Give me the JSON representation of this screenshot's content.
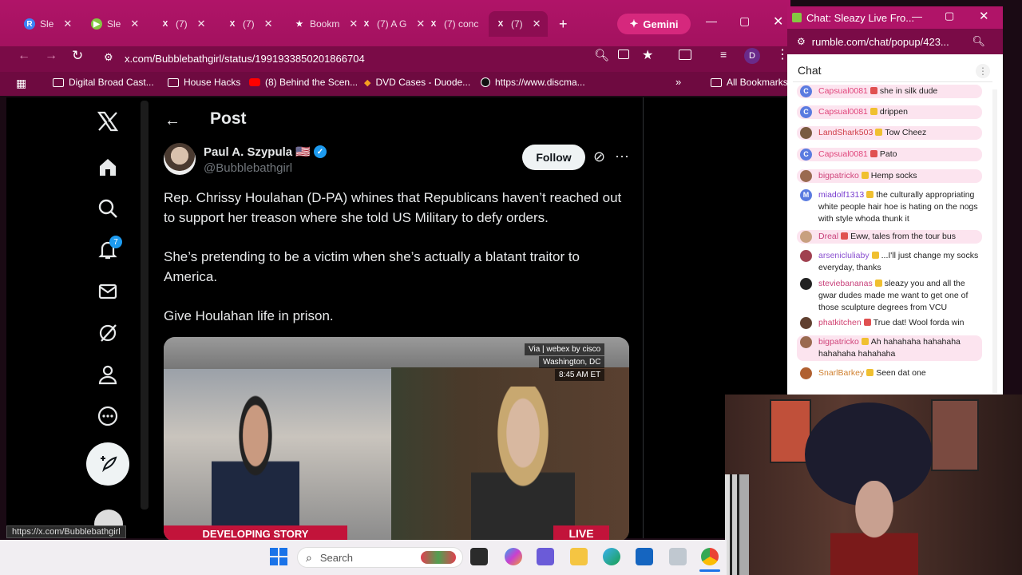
{
  "browser": {
    "tabs": [
      {
        "icon": "R",
        "label": "Sle",
        "color": "#3b82f6"
      },
      {
        "icon": "▶",
        "label": "Sle",
        "color": "#85c742"
      },
      {
        "icon": "X",
        "label": "(7)",
        "color": ""
      },
      {
        "icon": "X",
        "label": "(7)",
        "color": ""
      },
      {
        "icon": "★",
        "label": "Bookm",
        "color": ""
      },
      {
        "icon": "X",
        "label": "(7) A G",
        "color": ""
      },
      {
        "icon": "X",
        "label": "(7) conc",
        "color": ""
      },
      {
        "icon": "X",
        "label": "(7)",
        "color": ""
      }
    ],
    "gemini_label": "Gemini",
    "url": "x.com/Bubblebathgirl/status/1991933850201866704",
    "profile_initial": "D",
    "bookmarks": [
      "Digital Broad Cast...",
      "House Hacks",
      "(8) Behind the Scen...",
      "DVD Cases - Duode...",
      "https://www.discma...",
      "All Bookmarks"
    ],
    "status_url": "https://x.com/Bubblebathgirl"
  },
  "x": {
    "page_title": "Post",
    "notification_count": "7",
    "author_name": "Paul A. Szypula 🇺🇸",
    "author_handle": "@Bubblebathgirl",
    "follow_label": "Follow",
    "paragraphs": [
      "Rep. Chrissy Houlahan (D-PA) whines that Republicans haven’t reached out to support her treason where she told US Military to defy orders.",
      "She’s pretending to be a victim when she’s actually a blatant traitor to America.",
      "Give Houlahan life in prison."
    ],
    "media": {
      "via": "Via | webex by cisco",
      "location": "Washington, DC",
      "time": "8:45 AM ET",
      "banner": "DEVELOPING STORY",
      "live": "LIVE"
    }
  },
  "chat": {
    "window_title": "Chat: Sleazy Live Fro...",
    "url": "rumble.com/chat/popup/423...",
    "heading": "Chat",
    "messages": [
      {
        "user": "Capsual0081",
        "text": "she in silk dude",
        "color": "#e0457b",
        "av": "C",
        "avc": "#5a7be0",
        "hl": true
      },
      {
        "user": "Capsual0081",
        "text": "drippen",
        "color": "#e0457b",
        "av": "C",
        "avc": "#5a7be0",
        "hl": true
      },
      {
        "user": "LandShark503",
        "text": "Tow Cheez",
        "color": "#d0404a",
        "av": "",
        "avc": "#7a5a40",
        "hl": true
      },
      {
        "user": "Capsual0081",
        "text": "Pato",
        "color": "#e0457b",
        "av": "C",
        "avc": "#5a7be0",
        "hl": true
      },
      {
        "user": "bigpatricko",
        "text": "Hemp socks",
        "color": "#d0457b",
        "av": "",
        "avc": "#9a6a50",
        "hl": true
      },
      {
        "user": "miadolf1313",
        "text": "the culturally appropriating white people hair hoe is hating on the nogs with style whoda thunk it",
        "color": "#7a3fcf",
        "av": "M",
        "avc": "#5a7be0",
        "hl": false
      },
      {
        "user": "Dreal",
        "text": "Eww, tales from the tour bus",
        "color": "#c8407a",
        "av": "",
        "avc": "#c8a080",
        "hl": true
      },
      {
        "user": "arsenicluliaby",
        "text": "...I'll just change my socks everyday, thanks",
        "color": "#8a50d0",
        "av": "",
        "avc": "#a04050",
        "hl": false
      },
      {
        "user": "steviebananas",
        "text": "sleazy you and all the gwar dudes made me want to get one of those sculpture degrees from VCU",
        "color": "#c8407a",
        "av": "",
        "avc": "#222",
        "hl": false
      },
      {
        "user": "phatkitchen",
        "text": "True dat! Wool forda win",
        "color": "#d04070",
        "av": "",
        "avc": "#604030",
        "hl": false
      },
      {
        "user": "bigpatricko",
        "text": "Ah hahahaha hahahaha hahahaha hahahaha",
        "color": "#d0457b",
        "av": "",
        "avc": "#9a6a50",
        "hl": true
      },
      {
        "user": "SnarlBarkey",
        "text": "Seen dat one",
        "color": "#d08030",
        "av": "",
        "avc": "#b06030",
        "hl": false
      }
    ]
  },
  "taskbar": {
    "search_placeholder": "Search"
  },
  "colors": {
    "chrome": "#b01468",
    "x_background": "#000000",
    "x_blue": "#1d9bf0"
  }
}
